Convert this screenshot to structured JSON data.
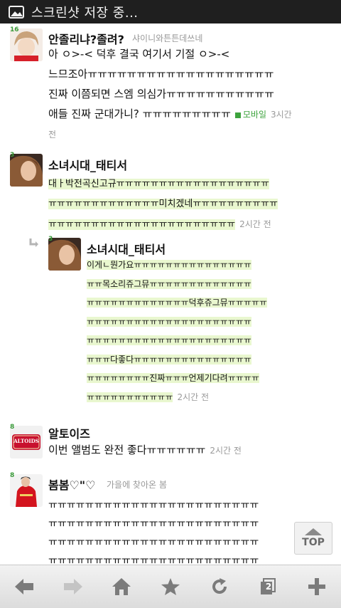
{
  "status_bar": {
    "title": "스크린샷 저장 중..."
  },
  "comments": [
    {
      "level": "16",
      "name": "안졸리냐?졸려?",
      "sub": "샤이니와튼튼데쓰네",
      "lines": [
        "아 ㅇ>-< 덕후 결국 여기서 기절 ㅇ>-<",
        "느므조아ㅠㅠㅠㅠㅠㅠㅠㅠㅠㅠㅠㅠㅠㅠㅠㅠㅠㅠㅠ",
        "진짜 이쯤되면 스엠 의심가ㅠㅠㅠㅠㅠㅠㅠㅠㅠㅠㅠ",
        "애들 진짜 군대가니? ㅠㅠㅠㅠㅠㅠㅠㅠㅠ"
      ],
      "mobile_label": "모바일",
      "time_a": "3시간",
      "time_b": "전"
    },
    {
      "level": "3",
      "name": "소녀시대_태티서",
      "lines": [
        "대ㅏ박전곡신고규ㅠㅠㅠㅠㅠㅠㅠㅠㅠㅠㅠㅠㅠㅠㅠㅠㅠㅠ",
        "ㅠㅠㅠㅠㅠㅠㅠㅠㅠㅠㅠㅠㅠ미치겠네ㅠㅠㅠㅠㅠㅠㅠㅠㅠㅠ",
        "ㅠㅠㅠㅠㅠㅠㅠㅠㅠㅠㅠㅠㅠㅠㅠㅠㅠㅠㅠㅠㅠㅠ"
      ],
      "time": "2시간 전"
    },
    {
      "level": "3",
      "name": "소녀시대_태티서",
      "lines": [
        "이게ㄴ뭔가요ㅠㅠㅠㅠㅠㅠㅠㅠㅠㅠㅠㅠㅠㅠㅠ",
        "ㅠㅠ목소리쥬그뮤ㅠㅠㅠㅠㅠㅠㅠㅠㅠㅠㅠㅠㅠ",
        "ㅠㅠㅠㅠㅠㅠㅠㅠㅠㅠㅠㅠㅠ덕후쥬그뮤ㅠㅠㅠㅠㅠ",
        "ㅠㅠㅠㅠㅠㅠㅠㅠㅠㅠㅠㅠㅠㅠㅠㅠㅠㅠㅠㅠㅠ",
        "ㅠㅠㅠㅠㅠㅠㅠㅠㅠㅠㅠㅠㅠㅠㅠㅠㅠㅠㅠㅠㅠ",
        "ㅠㅠㅠ다좋다ㅠㅠㅠㅠㅠㅠㅠㅠㅠㅠㅠㅠㅠㅠㅠ",
        "ㅠㅠㅠㅠㅠㅠㅠㅠ진짜ㅠㅠㅠ언제기다려ㅠㅠㅠㅠ",
        "ㅠㅠㅠㅠㅠㅠㅠㅠㅠㅠㅠ"
      ],
      "time": "2시간 전"
    },
    {
      "level": "8",
      "name": "알토이즈",
      "lines": [
        "이번 앨범도 완전 좋다ㅠㅠㅠㅠㅠㅠ"
      ],
      "time": "2시간 전",
      "avatar_text": "ALTOIDS"
    },
    {
      "level": "8",
      "name": "봄봄♡\"♡",
      "sub": "가을에 찾아온 봄",
      "lines": [
        "ㅠㅠㅠㅠㅠㅠㅠㅠㅠㅠㅠㅠㅠㅠㅠㅠㅠㅠㅠㅠㅠㅠㅠ",
        "ㅠㅠㅠㅠㅠㅠㅠㅠㅠㅠㅠㅠㅠㅠㅠㅠㅠㅠㅠㅠㅠㅠㅠ",
        "ㅠㅠㅠㅠㅠㅠㅠㅠㅠㅠㅠㅠㅠㅠㅠㅠㅠㅠㅠㅠㅠㅠㅠ",
        "ㅠㅠㅠㅠㅠㅠㅠㅠㅠㅠㅠㅠㅠㅠㅠㅠㅠㅠㅠㅠㅠㅠㅠ"
      ]
    }
  ],
  "top_button": {
    "label": "TOP"
  },
  "toolbar": {
    "tabs_count": "2"
  },
  "icons": [
    "image-icon",
    "back-arrow-icon",
    "forward-arrow-icon",
    "home-icon",
    "star-icon",
    "refresh-icon",
    "tabs-icon",
    "plus-icon",
    "reply-arrow-icon"
  ],
  "colors": {
    "highlight": "#e9f7cf",
    "mobile_green": "#3da33d",
    "level_green": "#3a9a3a"
  }
}
